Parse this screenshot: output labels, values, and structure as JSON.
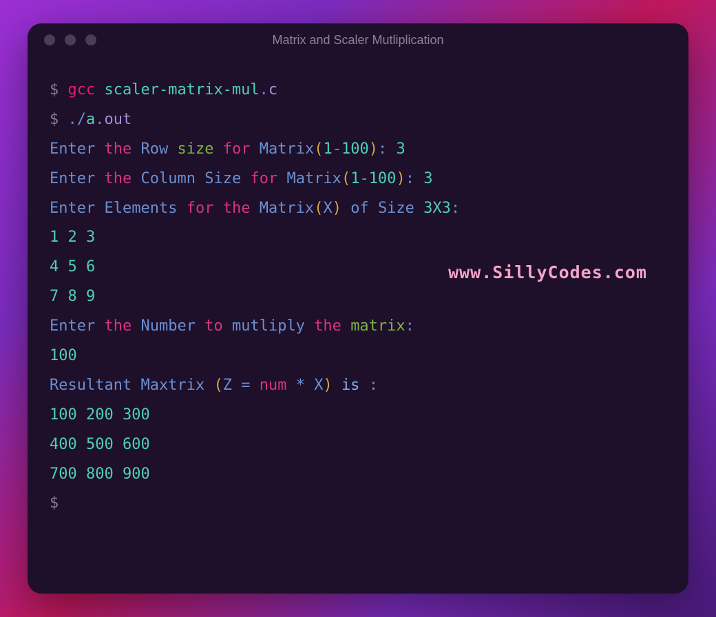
{
  "window": {
    "title": "Matrix and Scaler Mutliplication"
  },
  "watermark": "www.SillyCodes.com",
  "terminal": {
    "prompt": "$",
    "cmd1": {
      "gcc": "gcc",
      "file_base": "scaler-matrix-mul",
      "dot": ".",
      "ext": "c"
    },
    "cmd2": {
      "dotslash": "./",
      "a": "a",
      "dot": ".",
      "out": "out"
    },
    "row_prompt": {
      "enter": "Enter",
      "the": "the",
      "row": "Row",
      "size": "size",
      "for_": "for",
      "matrix": "Matrix",
      "lparen": "(",
      "one": "1",
      "dash": "-",
      "hundred": "100",
      "rparen": ")",
      "colon": ":",
      "value": "3"
    },
    "col_prompt": {
      "enter": "Enter",
      "the": "the",
      "column": "Column",
      "size": "Size",
      "for_": "for",
      "matrix": "Matrix",
      "lparen": "(",
      "one": "1",
      "dash": "-",
      "hundred": "100",
      "rparen": ")",
      "colon": ":",
      "value": "3"
    },
    "elem_prompt": {
      "enter": "Enter",
      "elements": "Elements",
      "for_": "for",
      "the": "the",
      "matrix": "Matrix",
      "lparen": "(",
      "x": "X",
      "rparen": ")",
      "of": "of",
      "size": "Size",
      "dims": "3X3",
      "colon": ":"
    },
    "input_matrix": {
      "r1": "1 2 3",
      "r2": "4 5 6",
      "r3": "7 8 9"
    },
    "num_prompt": {
      "enter": "Enter",
      "the": "the",
      "number": "Number",
      "to": "to",
      "multiply": "mutliply",
      "the2": "the",
      "matrix": "matrix",
      "colon": ":"
    },
    "num_value": "100",
    "result_prompt": {
      "resultant": "Resultant",
      "maxtrix": "Maxtrix",
      "lparen": "(",
      "z": "Z",
      "eq": "=",
      "num": "num",
      "star": "*",
      "x": "X",
      "rparen": ")",
      "is": "is",
      "colon": ":"
    },
    "result_matrix": {
      "r1": "100 200 300",
      "r2": "400 500 600",
      "r3": "700 800 900"
    }
  }
}
